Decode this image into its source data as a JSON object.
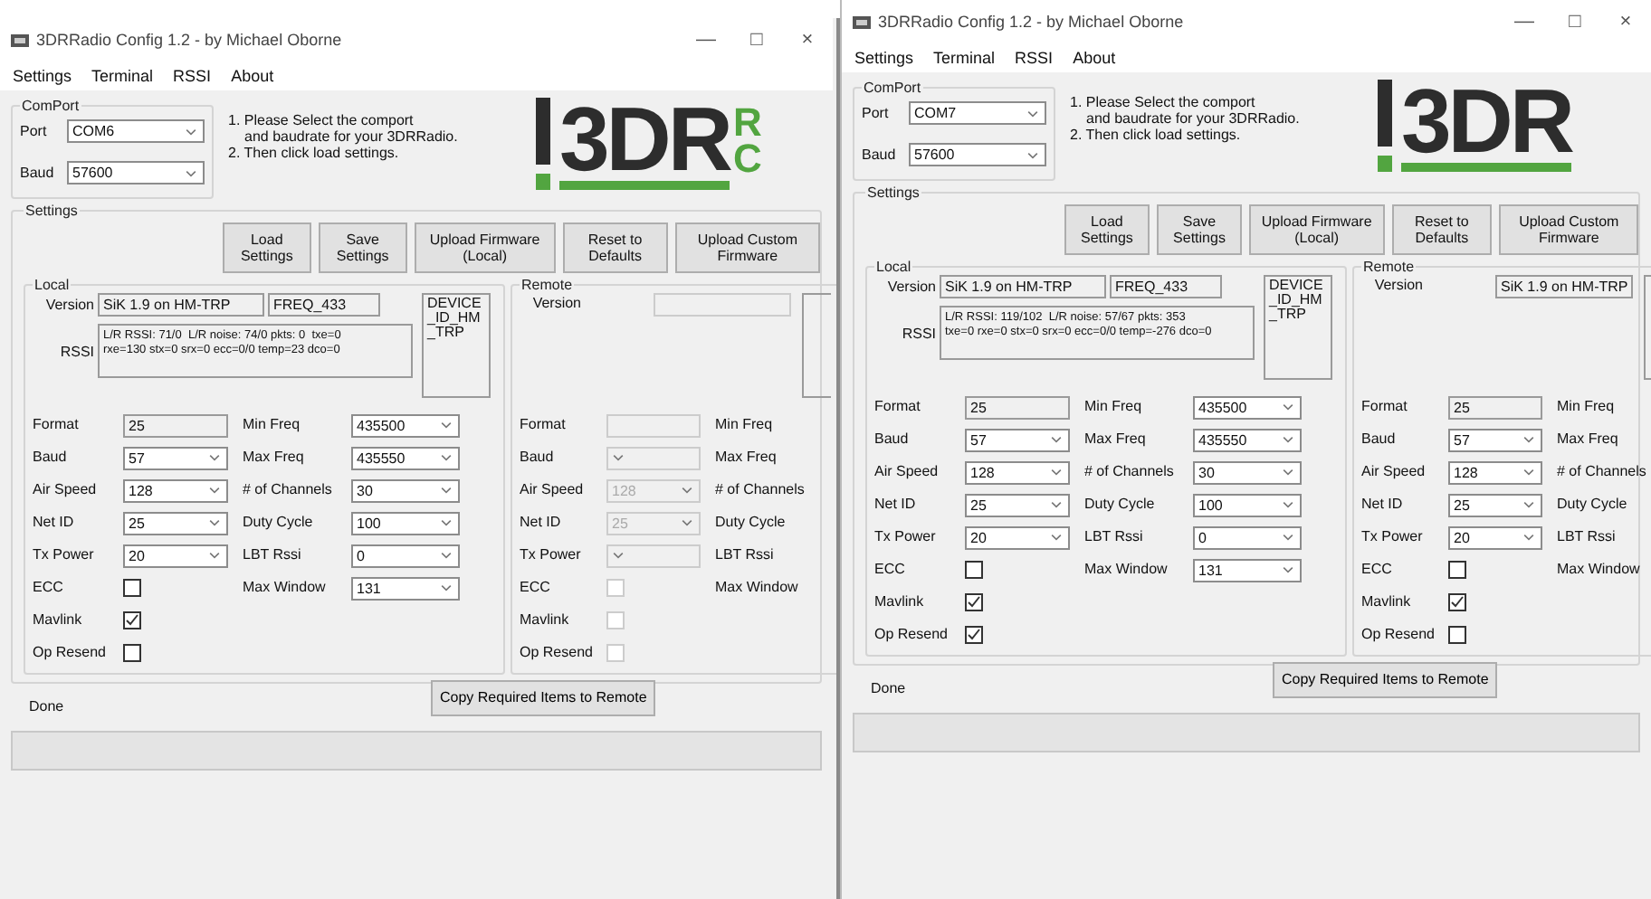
{
  "windows": [
    {
      "title": "3DRRadio Config 1.2 - by Michael Oborne",
      "controls": [
        "—",
        "□",
        "×"
      ],
      "menu": [
        "Settings",
        "Terminal",
        "RSSI",
        "About"
      ],
      "comport": {
        "title": "ComPort",
        "port_label": "Port",
        "port": "COM6",
        "baud_label": "Baud",
        "baud": "57600"
      },
      "instructions": [
        "1. Please Select the comport",
        "and baudrate for your 3DRRadio.",
        "2. Then click load settings."
      ],
      "logo": {
        "text": "3DR",
        "tail": [
          "R",
          "C"
        ]
      },
      "settings_title": "Settings",
      "buttons": [
        "Load Settings",
        "Save Settings",
        "Upload Firmware (Local)",
        "Reset to Defaults",
        "Upload Custom Firmware"
      ],
      "local": {
        "title": "Local",
        "disabled": false,
        "version_label": "Version",
        "version": "SiK 1.9 on HM-TRP",
        "freq": "FREQ_433",
        "device": "DEVICE_ID_HM_TRP",
        "rssi_label": "RSSI",
        "rssi": "L/R RSSI: 71/0  L/R noise: 74/0 pkts: 0  txe=0\nrxe=130 stx=0 srx=0 ecc=0/0 temp=23 dco=0",
        "fields": [
          {
            "label": "Format",
            "kind": "text",
            "value": "25"
          },
          {
            "label": "Baud",
            "kind": "combo",
            "value": "57"
          },
          {
            "label": "Air Speed",
            "kind": "combo",
            "value": "128"
          },
          {
            "label": "Net ID",
            "kind": "combo",
            "value": "25"
          },
          {
            "label": "Tx Power",
            "kind": "combo",
            "value": "20"
          }
        ],
        "fields2": [
          {
            "label": "Min Freq",
            "kind": "combo",
            "value": "435500"
          },
          {
            "label": "Max Freq",
            "kind": "combo",
            "value": "435550"
          },
          {
            "label": "# of Channels",
            "kind": "combo",
            "value": "30"
          },
          {
            "label": "Duty Cycle",
            "kind": "combo",
            "value": "100"
          },
          {
            "label": "LBT Rssi",
            "kind": "combo",
            "value": "0"
          },
          {
            "label": "Max Window",
            "kind": "combo",
            "value": "131"
          }
        ],
        "checks": [
          {
            "label": "ECC",
            "checked": false
          },
          {
            "label": "Mavlink",
            "checked": true
          },
          {
            "label": "Op Resend",
            "checked": false
          }
        ]
      },
      "remote": {
        "title": "Remote",
        "disabled": true,
        "version_label": "Version",
        "fields": [
          {
            "label": "Format",
            "kind": "text"
          },
          {
            "label": "Baud",
            "kind": "combo"
          },
          {
            "label": "Air Speed",
            "kind": "combo",
            "value": "128"
          },
          {
            "label": "Net ID",
            "kind": "combo",
            "value": "25"
          },
          {
            "label": "Tx Power",
            "kind": "combo"
          }
        ],
        "fields2": [
          {
            "label": "Min Freq"
          },
          {
            "label": "Max Freq"
          },
          {
            "label": "# of Channels"
          },
          {
            "label": "Duty Cycle"
          },
          {
            "label": "LBT Rssi"
          },
          {
            "label": "Max Window"
          }
        ],
        "checks": [
          {
            "label": "ECC",
            "checked": false
          },
          {
            "label": "Mavlink",
            "checked": false
          },
          {
            "label": "Op Resend",
            "checked": false
          }
        ]
      },
      "status": "Done",
      "copy_button": "Copy Required Items to Remote"
    },
    {
      "title": "3DRRadio Config 1.2 - by Michael Oborne",
      "controls": [
        "—",
        "□",
        "×"
      ],
      "menu": [
        "Settings",
        "Terminal",
        "RSSI",
        "About"
      ],
      "comport": {
        "title": "ComPort",
        "port_label": "Port",
        "port": "COM7",
        "baud_label": "Baud",
        "baud": "57600"
      },
      "instructions": [
        "1. Please Select the comport",
        "and baudrate for your 3DRRadio.",
        "2. Then click load settings."
      ],
      "logo": {
        "text": "3DR"
      },
      "settings_title": "Settings",
      "buttons": [
        "Load Settings",
        "Save Settings",
        "Upload Firmware (Local)",
        "Reset to Defaults",
        "Upload Custom Firmware"
      ],
      "local": {
        "title": "Local",
        "disabled": false,
        "version_label": "Version",
        "version": "SiK 1.9 on HM-TRP",
        "freq": "FREQ_433",
        "device": "DEVICE_ID_HM_TRP",
        "rssi_label": "RSSI",
        "rssi": "L/R RSSI: 119/102  L/R noise: 57/67 pkts: 353\ntxe=0 rxe=0 stx=0 srx=0 ecc=0/0 temp=-276 dco=0",
        "fields": [
          {
            "label": "Format",
            "kind": "text",
            "value": "25"
          },
          {
            "label": "Baud",
            "kind": "combo",
            "value": "57"
          },
          {
            "label": "Air Speed",
            "kind": "combo",
            "value": "128"
          },
          {
            "label": "Net ID",
            "kind": "combo",
            "value": "25"
          },
          {
            "label": "Tx Power",
            "kind": "combo",
            "value": "20"
          }
        ],
        "fields2": [
          {
            "label": "Min Freq",
            "kind": "combo",
            "value": "435500"
          },
          {
            "label": "Max Freq",
            "kind": "combo",
            "value": "435550"
          },
          {
            "label": "# of Channels",
            "kind": "combo",
            "value": "30"
          },
          {
            "label": "Duty Cycle",
            "kind": "combo",
            "value": "100"
          },
          {
            "label": "LBT Rssi",
            "kind": "combo",
            "value": "0"
          },
          {
            "label": "Max Window",
            "kind": "combo",
            "value": "131"
          }
        ],
        "checks": [
          {
            "label": "ECC",
            "checked": false
          },
          {
            "label": "Mavlink",
            "checked": true
          },
          {
            "label": "Op Resend",
            "checked": true
          }
        ]
      },
      "remote": {
        "title": "Remote",
        "disabled": false,
        "version_label": "Version",
        "version": "SiK 1.9 on HM-TRP",
        "fields": [
          {
            "label": "Format",
            "kind": "text",
            "value": "25"
          },
          {
            "label": "Baud",
            "kind": "combo",
            "value": "57"
          },
          {
            "label": "Air Speed",
            "kind": "combo",
            "value": "128"
          },
          {
            "label": "Net ID",
            "kind": "combo",
            "value": "25"
          },
          {
            "label": "Tx Power",
            "kind": "combo",
            "value": "20"
          }
        ],
        "fields2": [
          {
            "label": "Min Freq"
          },
          {
            "label": "Max Freq"
          },
          {
            "label": "# of Channels"
          },
          {
            "label": "Duty Cycle"
          },
          {
            "label": "LBT Rssi"
          },
          {
            "label": "Max Window"
          }
        ],
        "checks": [
          {
            "label": "ECC",
            "checked": false
          },
          {
            "label": "Mavlink",
            "checked": true
          },
          {
            "label": "Op Resend",
            "checked": false
          }
        ]
      },
      "status": "Done",
      "copy_button": "Copy Required Items to Remote"
    }
  ]
}
